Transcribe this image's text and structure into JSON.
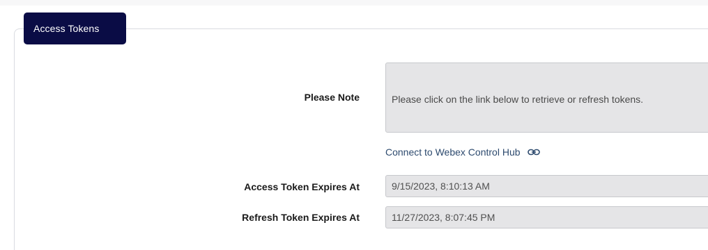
{
  "section": {
    "tab_label": "Access Tokens"
  },
  "note": {
    "label": "Please Note",
    "text": "Please click on the link below to retrieve or refresh tokens."
  },
  "link": {
    "text": "Connect to Webex Control Hub",
    "icon": "link-icon"
  },
  "fields": {
    "access_label": "Access Token Expires At",
    "access_value": "9/15/2023, 8:10:13 AM",
    "refresh_label": "Refresh Token Expires At",
    "refresh_value": "11/27/2023, 8:07:45 PM"
  },
  "colors": {
    "tab_bg": "#0a0c45",
    "link": "#2d4a6e",
    "field_bg": "#e5e5e7"
  }
}
